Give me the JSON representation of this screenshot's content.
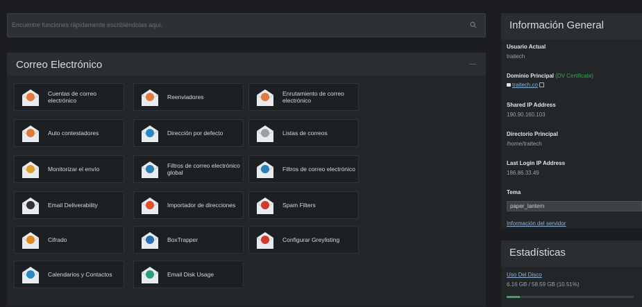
{
  "search": {
    "placeholder": "Encuentre funciones rápidamente escribiéndolas aquí."
  },
  "email_section": {
    "title": "Correo Electrónico",
    "tiles": [
      {
        "label": "Cuentas de correo electrónico",
        "icon": "email-accounts-icon",
        "color": "#e07b39"
      },
      {
        "label": "Reenviadores",
        "icon": "forwarders-icon",
        "color": "#e07b39"
      },
      {
        "label": "Enrutamiento de correo electrónico",
        "icon": "email-routing-icon",
        "color": "#e07b39"
      },
      {
        "label": "Auto contestadores",
        "icon": "autoresponders-icon",
        "color": "#e07b39"
      },
      {
        "label": "Dirección por defecto",
        "icon": "default-address-icon",
        "color": "#2a88c8"
      },
      {
        "label": "Listas de correos",
        "icon": "mailing-lists-icon",
        "color": "#9aa0a6"
      },
      {
        "label": "Monitorizar el envío",
        "icon": "track-delivery-icon",
        "color": "#e0a030"
      },
      {
        "label": "Filtros de correo electrónico global",
        "icon": "global-filters-icon",
        "color": "#2a7fb5"
      },
      {
        "label": "Filtros de correo electrónico",
        "icon": "email-filters-icon",
        "color": "#2a7fb5"
      },
      {
        "label": "Email Deliverability",
        "icon": "deliverability-icon",
        "color": "#333333"
      },
      {
        "label": "Importador de direcciones",
        "icon": "address-importer-icon",
        "color": "#e0502a"
      },
      {
        "label": "Spam Filters",
        "icon": "spam-filters-icon",
        "color": "#d03a2a"
      },
      {
        "label": "Cifrado",
        "icon": "encryption-icon",
        "color": "#e08a20"
      },
      {
        "label": "BoxTrapper",
        "icon": "boxtrapper-icon",
        "color": "#2a6fb5"
      },
      {
        "label": "Configurar Greylisting",
        "icon": "greylisting-icon",
        "color": "#d03a2a"
      },
      {
        "label": "Calendarios y Contactos",
        "icon": "calendar-icon",
        "color": "#2a88c8"
      },
      {
        "label": "Email Disk Usage",
        "icon": "disk-usage-icon",
        "color": "#2aa07a"
      }
    ]
  },
  "general_info": {
    "title": "Información General",
    "current_user_label": "Usuario Actual",
    "current_user": "traitech",
    "primary_domain_label": "Dominio Principal",
    "dv_cert": "(DV Certificate)",
    "primary_domain": "traitech.co",
    "shared_ip_label": "Shared IP Address",
    "shared_ip": "190.90.160.103",
    "home_dir_label": "Directorio Principal",
    "home_dir": "/home/traitech",
    "last_login_label": "Last Login IP Address",
    "last_login": "186.86.33.49",
    "theme_label": "Tema",
    "theme_value": "paper_lantern",
    "server_info_link": "Información del servidor"
  },
  "stats": {
    "title": "Estadísticas",
    "disk_label": "Uso Del Disco",
    "disk_value": "6.16 GB / 58.59 GB  (10.51%)",
    "disk_fraction": 0.1051
  }
}
